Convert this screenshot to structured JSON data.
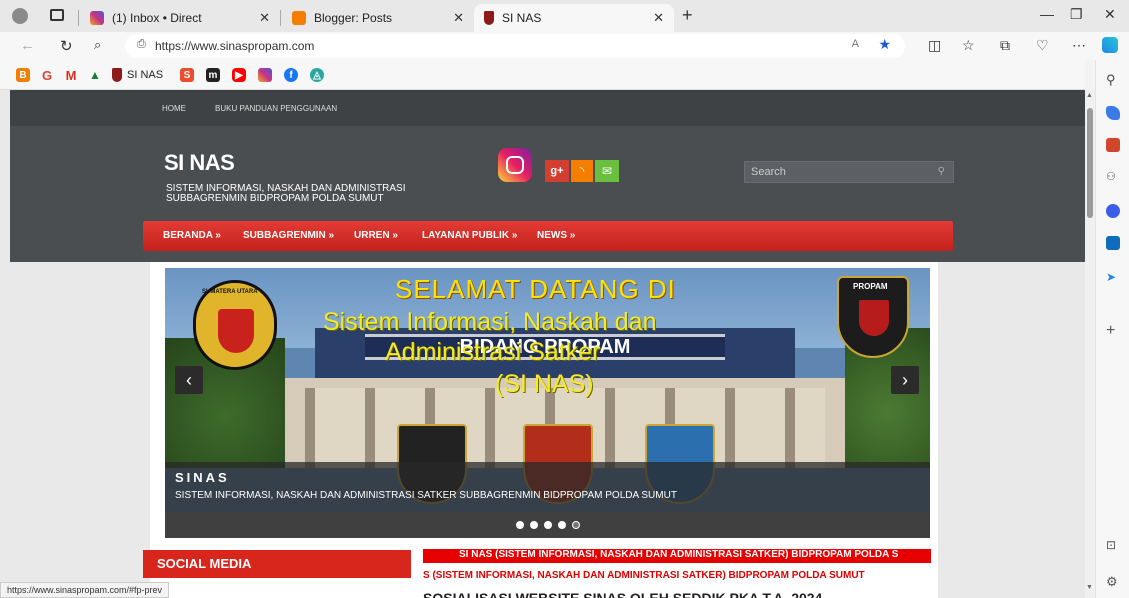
{
  "tabs": [
    {
      "title": "(1) Inbox • Direct",
      "color": "#c13584"
    },
    {
      "title": "Blogger: Posts",
      "color": "#f57d00"
    },
    {
      "title": "SI NAS",
      "color": "#8b1a1a"
    }
  ],
  "address": {
    "url": "https://www.sinaspropam.com"
  },
  "bookmarks": {
    "sinas_label": "SI NAS"
  },
  "site": {
    "topnav": [
      "HOME",
      "BUKU PANDUAN PENGGUNAAN"
    ],
    "title": "SI NAS",
    "subtitle_line1": "SISTEM INFORMASI, NASKAH DAN ADMINISTRASI",
    "subtitle_line2": "SUBBAGRENMIN BIDPROPAM POLDA SUMUT",
    "search_placeholder": "Search",
    "menu": [
      "BERANDA »",
      "SUBBAGRENMIN »",
      "URREN »",
      "LAYANAN PUBLIK »",
      "NEWS »"
    ]
  },
  "slider": {
    "badge_left": "SUMATERA UTARA",
    "badge_right": "PROPAM",
    "banner_line1": "SELAMAT DATANG DI",
    "banner_line2": "Sistem Informasi, Naskah dan",
    "banner_line3": "Administrasi Satker",
    "banner_line4": "(SI NAS)",
    "building_sign": "BIDANG PROPAM",
    "caption_title": "SINAS",
    "caption_sub": "SISTEM INFORMASI, NASKAH DAN ADMINISTRASI SATKER SUBBAGRENMIN BIDPROPAM POLDA SUMUT",
    "dot_count": 5,
    "active_dot": 4
  },
  "sidebar": {
    "social_media_title": "SOCIAL MEDIA"
  },
  "ticker": {
    "line1": "SI NAS (SISTEM INFORMASI, NASKAH DAN ADMINISTRASI SATKER) BIDPROPAM POLDA S",
    "line2": "S (SISTEM INFORMASI, NASKAH DAN ADMINISTRASI SATKER) BIDPROPAM POLDA SUMUT"
  },
  "post": {
    "title": "SOSIALISASI WEBSITE SINAS OLEH SEDDIK PKA T.A. 2024"
  },
  "status": {
    "link": "https://www.sinaspropam.com/#fp-prev"
  }
}
